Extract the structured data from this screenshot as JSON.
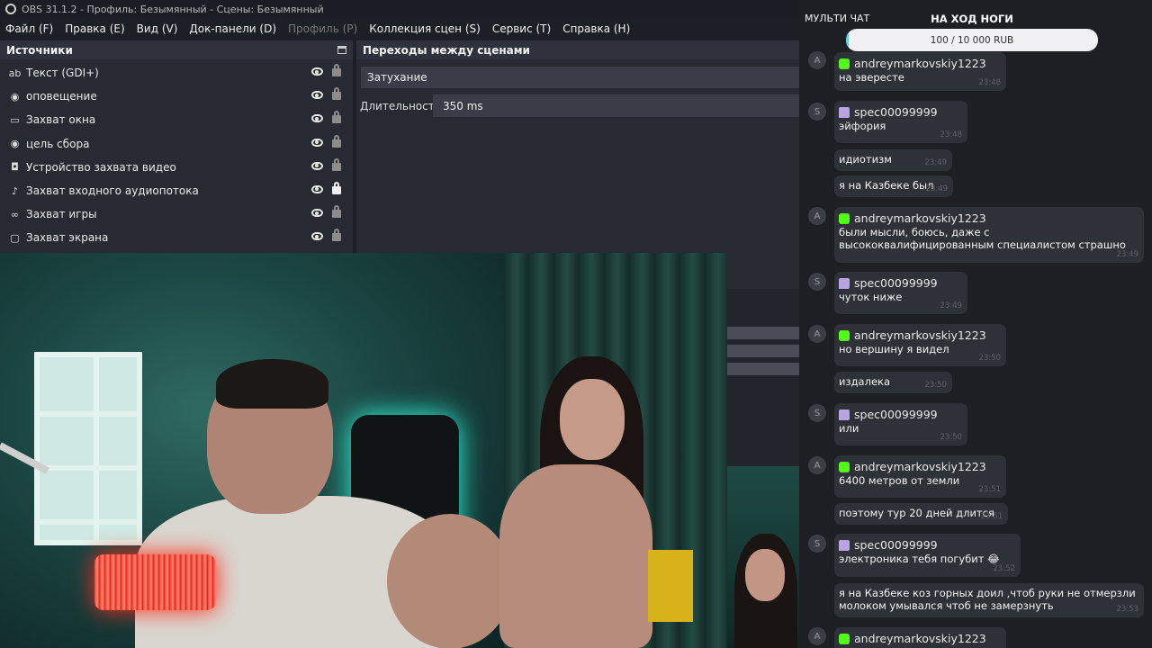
{
  "window": {
    "title": "OBS 31.1.2 - Профиль: Безымянный - Сцены: Безымянный"
  },
  "menu": [
    {
      "label": "Файл (F)",
      "disabled": false
    },
    {
      "label": "Правка (E)",
      "disabled": false
    },
    {
      "label": "Вид (V)",
      "disabled": false
    },
    {
      "label": "Док-панели (D)",
      "disabled": false
    },
    {
      "label": "Профиль (P)",
      "disabled": true
    },
    {
      "label": "Коллекция сцен (S)",
      "disabled": false
    },
    {
      "label": "Сервис (T)",
      "disabled": false
    },
    {
      "label": "Справка (H)",
      "disabled": false
    }
  ],
  "sources": {
    "title": "Источники",
    "items": [
      {
        "label": "Текст (GDI+)",
        "icon": "text-icon",
        "locked": false
      },
      {
        "label": "оповещение",
        "icon": "globe-icon",
        "locked": false
      },
      {
        "label": "Захват окна",
        "icon": "window-icon",
        "locked": false
      },
      {
        "label": "цель сбора",
        "icon": "globe-icon",
        "locked": false
      },
      {
        "label": "Устройство захвата видео",
        "icon": "camera-icon",
        "locked": false
      },
      {
        "label": "Захват входного аудиопотока",
        "icon": "microphone-icon",
        "locked": true
      },
      {
        "label": "Захват игры",
        "icon": "gamepad-icon",
        "locked": false
      },
      {
        "label": "Захват экрана",
        "icon": "monitor-icon",
        "locked": false
      }
    ]
  },
  "transitions": {
    "title": "Переходы между сценами",
    "selected": "Затухание",
    "duration_label": "Длительность",
    "duration_value": "350 ms"
  },
  "chat": {
    "title": "МУЛЬТИ ЧАТ",
    "goal": {
      "title": "НА ХОД НОГИ",
      "text": "100 / 10 000 RUB",
      "progress": 0.01
    },
    "colors": {
      "kick": "#53fc18",
      "twitch": "#b9a3e3"
    },
    "messages": [
      {
        "avatar": "A",
        "platform": "kick",
        "name": "andreymarkovskiy1223",
        "lines": [
          {
            "text": "на эвересте",
            "time": "23:48"
          }
        ]
      },
      {
        "avatar": "S",
        "platform": "twitch",
        "name": "spec00099999",
        "lines": [
          {
            "text": "эйфория",
            "time": "23:48"
          },
          {
            "text": "идиотизм",
            "time": "23:49"
          },
          {
            "text": "я на Казбеке был",
            "time": "23:49"
          }
        ]
      },
      {
        "avatar": "A",
        "platform": "kick",
        "name": "andreymarkovskiy1223",
        "lines": [
          {
            "text": "были мысли, боюсь, даже с\nвысококвалифицированным специалистом страшно",
            "time": "23:49"
          }
        ]
      },
      {
        "avatar": "S",
        "platform": "twitch",
        "name": "spec00099999",
        "lines": [
          {
            "text": "чуток ниже",
            "time": "23:49"
          }
        ]
      },
      {
        "avatar": "A",
        "platform": "kick",
        "name": "andreymarkovskiy1223",
        "lines": [
          {
            "text": "но вершину я видел",
            "time": "23:50"
          },
          {
            "text": "издалека",
            "time": "23:50"
          }
        ]
      },
      {
        "avatar": "S",
        "platform": "twitch",
        "name": "spec00099999",
        "lines": [
          {
            "text": "или",
            "time": "23:50"
          }
        ]
      },
      {
        "avatar": "A",
        "platform": "kick",
        "name": "andreymarkovskiy1223",
        "lines": [
          {
            "text": "6400 метров от земли",
            "time": "23:51"
          },
          {
            "text": "поэтому тур 20 дней длится",
            "time": "23:51"
          }
        ]
      },
      {
        "avatar": "S",
        "platform": "twitch",
        "name": "spec00099999",
        "lines": [
          {
            "text": "электроника тебя погубит 😂",
            "time": "23:52"
          },
          {
            "text": "я на Казбеке коз горных доил ,чтоб руки не отмерзли\nмолоком умывался чтоб не замерзнуть",
            "time": "23:53"
          }
        ]
      },
      {
        "avatar": "A",
        "platform": "kick",
        "name": "andreymarkovskiy1223",
        "lines": []
      }
    ]
  }
}
